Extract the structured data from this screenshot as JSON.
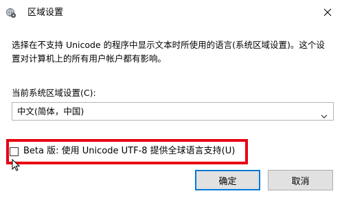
{
  "window": {
    "title": "区域设置",
    "icons": {
      "app": "globe-settings-icon",
      "close": "close-icon"
    }
  },
  "content": {
    "description": "选择在不支持 Unicode 的程序中显示文本时所使用的语言(系统区域设置)。这个设置对计算机上的所有用户帐户都有影响。",
    "locale_label": "当前系统区域设置(C):",
    "locale_value": "中文(简体，中国)",
    "beta_checkbox": {
      "label": "Beta 版: 使用 Unicode UTF-8 提供全球语言支持(U)",
      "checked": false
    }
  },
  "buttons": {
    "ok": "确定",
    "cancel": "取消"
  },
  "colors": {
    "highlight": "#e60012",
    "default_button_border": "#0078d7",
    "button_face": "#e1e1e1"
  }
}
